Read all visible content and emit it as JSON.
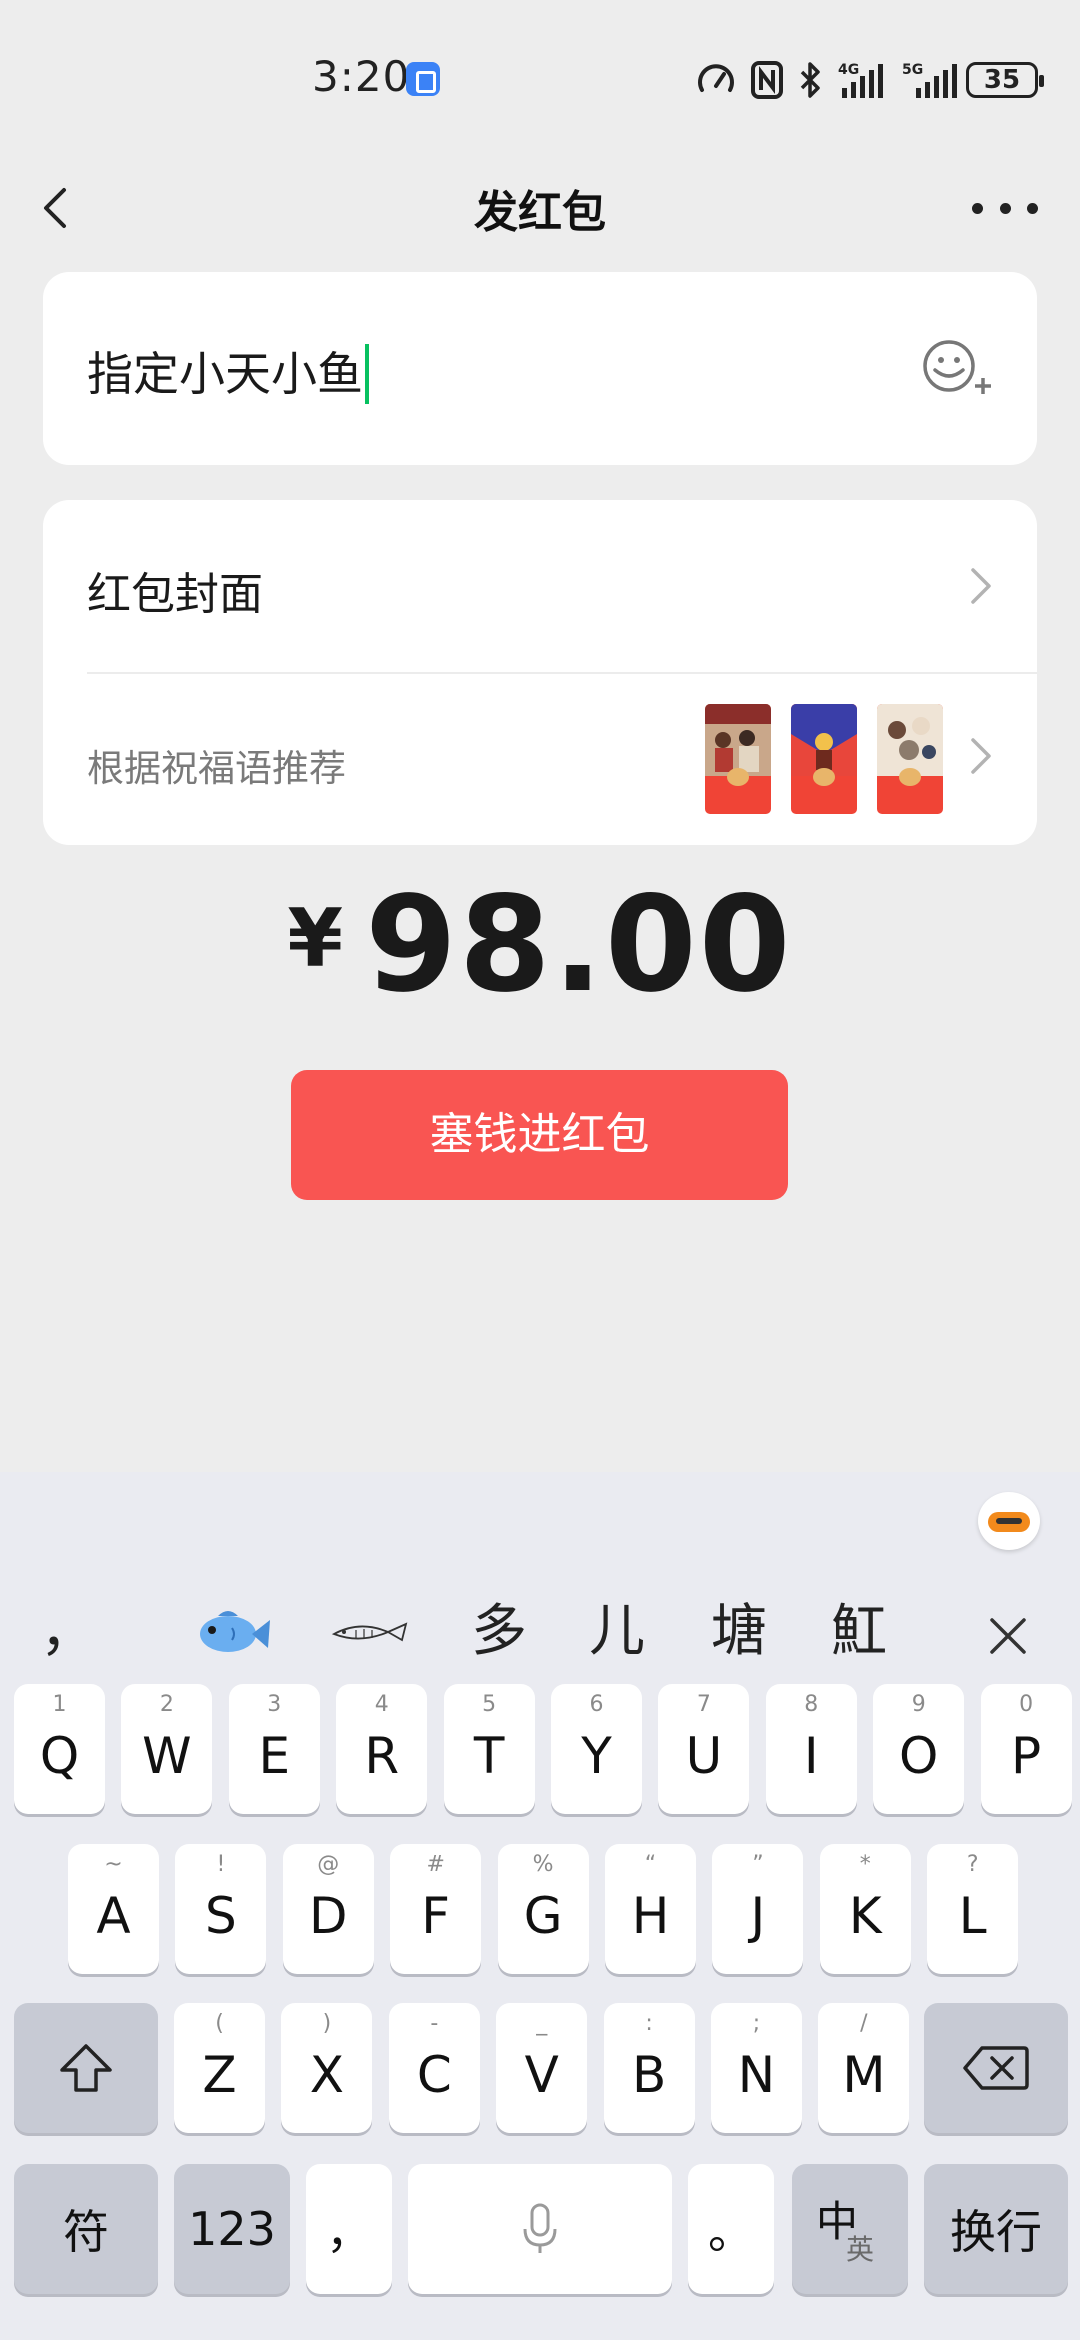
{
  "status_bar": {
    "time": "3:20",
    "battery": "35"
  },
  "nav": {
    "title": "发红包"
  },
  "message": {
    "value": "指定小天小鱼"
  },
  "cover": {
    "label": "红包封面",
    "recommend_label": "根据祝福语推荐"
  },
  "amount": {
    "currency": "¥",
    "value": "98.00"
  },
  "send_button": "塞钱进红包",
  "keyboard": {
    "candidates": [
      "，",
      "多",
      "儿",
      "塘",
      "魟"
    ],
    "row1": [
      {
        "key": "Q",
        "hint": "1"
      },
      {
        "key": "W",
        "hint": "2"
      },
      {
        "key": "E",
        "hint": "3"
      },
      {
        "key": "R",
        "hint": "4"
      },
      {
        "key": "T",
        "hint": "5"
      },
      {
        "key": "Y",
        "hint": "6"
      },
      {
        "key": "U",
        "hint": "7"
      },
      {
        "key": "I",
        "hint": "8"
      },
      {
        "key": "O",
        "hint": "9"
      },
      {
        "key": "P",
        "hint": "0"
      }
    ],
    "row2": [
      {
        "key": "A",
        "hint": "~"
      },
      {
        "key": "S",
        "hint": "!"
      },
      {
        "key": "D",
        "hint": "@"
      },
      {
        "key": "F",
        "hint": "#"
      },
      {
        "key": "G",
        "hint": "%"
      },
      {
        "key": "H",
        "hint": "“"
      },
      {
        "key": "J",
        "hint": "”"
      },
      {
        "key": "K",
        "hint": "*"
      },
      {
        "key": "L",
        "hint": "?"
      }
    ],
    "row3": [
      {
        "key": "Z",
        "hint": "("
      },
      {
        "key": "X",
        "hint": ")"
      },
      {
        "key": "C",
        "hint": "-"
      },
      {
        "key": "V",
        "hint": "_"
      },
      {
        "key": "B",
        "hint": ":"
      },
      {
        "key": "N",
        "hint": ";"
      },
      {
        "key": "M",
        "hint": "/"
      }
    ],
    "symbols_key": "符",
    "numbers_key": "123",
    "comma_key": "，",
    "period_key": "。",
    "lang_key_main": "中",
    "lang_key_sub": "英",
    "enter_key": "换行"
  }
}
